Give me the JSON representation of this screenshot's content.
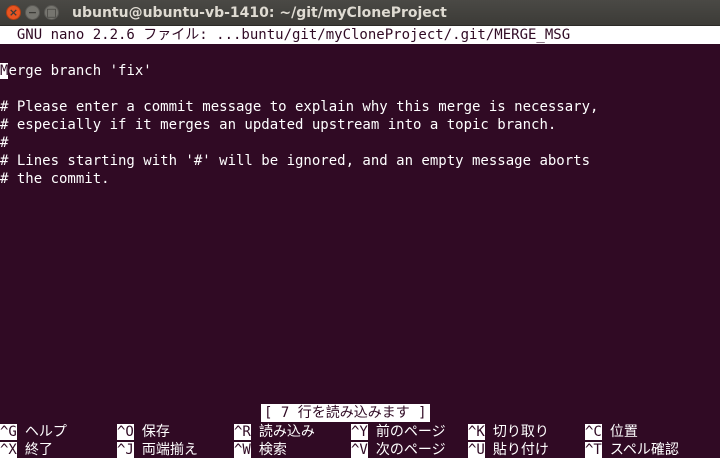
{
  "window": {
    "title": "ubuntu@ubuntu-vb-1410: ~/git/myCloneProject"
  },
  "nano": {
    "header": "  GNU nano 2.2.6 ファイル: ...buntu/git/myCloneProject/.git/MERGE_MSG",
    "cursor_char": "M",
    "first_line_rest": "erge branch 'fix'",
    "lines": [
      "",
      "# Please enter a commit message to explain why this merge is necessary,",
      "# especially if it merges an updated upstream into a topic branch.",
      "#",
      "# Lines starting with '#' will be ignored, and an empty message aborts",
      "# the commit."
    ],
    "status": "[ 7 行を読み込みます ]"
  },
  "shortcuts": {
    "row1": [
      {
        "key": "^G",
        "label": "ヘルプ"
      },
      {
        "key": "^O",
        "label": "保存"
      },
      {
        "key": "^R",
        "label": "読み込み"
      },
      {
        "key": "^Y",
        "label": "前のページ"
      },
      {
        "key": "^K",
        "label": "切り取り"
      },
      {
        "key": "^C",
        "label": "位置"
      }
    ],
    "row2": [
      {
        "key": "^X",
        "label": "終了"
      },
      {
        "key": "^J",
        "label": "両端揃え"
      },
      {
        "key": "^W",
        "label": "検索"
      },
      {
        "key": "^V",
        "label": "次のページ"
      },
      {
        "key": "^U",
        "label": "貼り付け"
      },
      {
        "key": "^T",
        "label": "スペル確認"
      }
    ]
  },
  "colors": {
    "terminal_bg": "#300a24",
    "accent_close": "#e95420",
    "titlebar": "#3c3b37"
  }
}
